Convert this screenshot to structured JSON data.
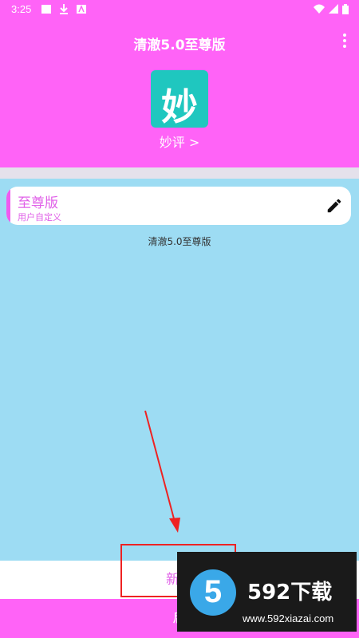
{
  "status_bar": {
    "time": "3:25",
    "icons": [
      "image-icon",
      "download-icon",
      "a-icon",
      "wifi-icon",
      "signal-icon",
      "battery-icon"
    ]
  },
  "app_bar": {
    "title": "清澈5.0至尊版",
    "menu_icon": "more-vert-icon"
  },
  "logo": {
    "glyph": "妙",
    "label": "妙评 >"
  },
  "card": {
    "title": "至尊版",
    "subtitle": "用户自定义",
    "edit_icon": "pencil-icon"
  },
  "config_name": "清澈5.0至尊版",
  "buttons": {
    "add_label": "新增",
    "start_label": "启"
  },
  "watermark": {
    "number": "5",
    "brand": "592下载",
    "url": "www.592xiazai.com"
  },
  "colors": {
    "primary": "#ff63f7",
    "content_bg": "#9ddcf3",
    "logo_bg": "#1fc7bf",
    "accent_text": "#e060e8",
    "annotation": "#e22222"
  }
}
